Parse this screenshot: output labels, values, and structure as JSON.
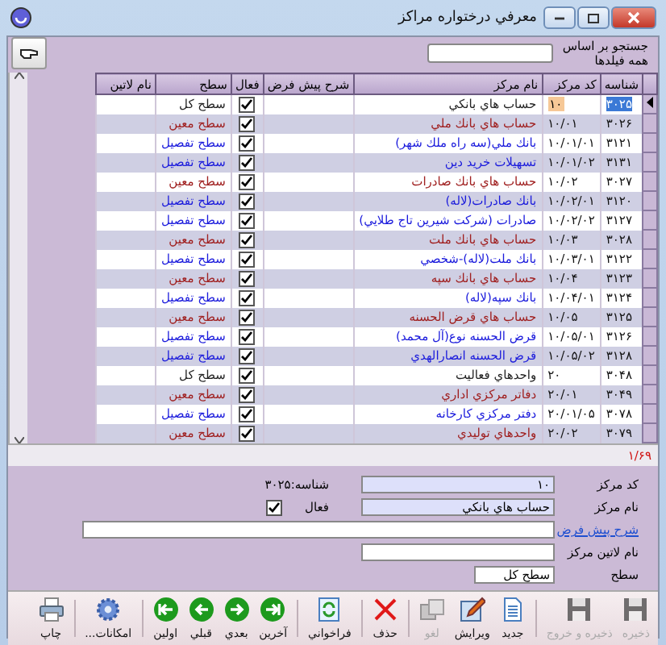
{
  "window": {
    "title": "معرفي درختواره مراكز"
  },
  "search": {
    "label_lines": [
      "جستجو بر اساس",
      "همه فيلدها"
    ]
  },
  "grid": {
    "columns": [
      "شناسه",
      "كد مركز",
      "نام مركز",
      "شرح پيش فرض",
      "فعال",
      "سطح",
      "نام لاتين"
    ],
    "rows": [
      {
        "id": "۳۰۲۵",
        "code": "۱۰",
        "name": "حساب هاي بانكي",
        "active": true,
        "level": "سطح كل",
        "kind": "total",
        "selected": true
      },
      {
        "id": "۳۰۲۶",
        "code": "۱۰/۰۱",
        "name": "حساب هاي بانك ملي",
        "active": true,
        "level": "سطح معين",
        "kind": "ledger",
        "selected": false
      },
      {
        "id": "۳۱۲۱",
        "code": "۱۰/۰۱/۰۱",
        "name": "بانك ملي(سه راه ملك شهر)",
        "active": true,
        "level": "سطح تفصيل",
        "kind": "detail",
        "selected": false
      },
      {
        "id": "۳۱۳۱",
        "code": "۱۰/۰۱/۰۲",
        "name": "تسهيلات خريد دين",
        "active": true,
        "level": "سطح تفصيل",
        "kind": "detail",
        "selected": false
      },
      {
        "id": "۳۰۲۷",
        "code": "۱۰/۰۲",
        "name": "حساب هاي بانك صادرات",
        "active": true,
        "level": "سطح معين",
        "kind": "ledger",
        "selected": false
      },
      {
        "id": "۳۱۲۰",
        "code": "۱۰/۰۲/۰۱",
        "name": "بانك صادرات(لاله)",
        "active": true,
        "level": "سطح تفصيل",
        "kind": "detail",
        "selected": false
      },
      {
        "id": "۳۱۲۷",
        "code": "۱۰/۰۲/۰۲",
        "name": "صادرات (شركت شيرين تاج طلايي)",
        "active": true,
        "level": "سطح تفصيل",
        "kind": "detail",
        "selected": false
      },
      {
        "id": "۳۰۲۸",
        "code": "۱۰/۰۳",
        "name": "حساب هاي بانك ملت",
        "active": true,
        "level": "سطح معين",
        "kind": "ledger",
        "selected": false
      },
      {
        "id": "۳۱۲۲",
        "code": "۱۰/۰۳/۰۱",
        "name": "بانك ملت(لاله)-شخصي",
        "active": true,
        "level": "سطح تفصيل",
        "kind": "detail",
        "selected": false
      },
      {
        "id": "۳۱۲۳",
        "code": "۱۰/۰۴",
        "name": "حساب هاي بانك سپه",
        "active": true,
        "level": "سطح معين",
        "kind": "ledger",
        "selected": false
      },
      {
        "id": "۳۱۲۴",
        "code": "۱۰/۰۴/۰۱",
        "name": "بانك سپه(لاله)",
        "active": true,
        "level": "سطح تفصيل",
        "kind": "detail",
        "selected": false
      },
      {
        "id": "۳۱۲۵",
        "code": "۱۰/۰۵",
        "name": "حساب هاي قرض الحسنه",
        "active": true,
        "level": "سطح معين",
        "kind": "ledger",
        "selected": false
      },
      {
        "id": "۳۱۲۶",
        "code": "۱۰/۰۵/۰۱",
        "name": "قرض الحسنه نوع(آل محمد)",
        "active": true,
        "level": "سطح تفصيل",
        "kind": "detail",
        "selected": false
      },
      {
        "id": "۳۱۲۸",
        "code": "۱۰/۰۵/۰۲",
        "name": "قرض الحسنه انصارالهدي",
        "active": true,
        "level": "سطح تفصيل",
        "kind": "detail",
        "selected": false
      },
      {
        "id": "۳۰۴۸",
        "code": "۲۰",
        "name": "واحدهاي فعاليت",
        "active": true,
        "level": "سطح كل",
        "kind": "total",
        "selected": false
      },
      {
        "id": "۳۰۴۹",
        "code": "۲۰/۰۱",
        "name": "دفاتر مركزي اداري",
        "active": true,
        "level": "سطح معين",
        "kind": "ledger",
        "selected": false
      },
      {
        "id": "۳۰۷۸",
        "code": "۲۰/۰۱/۰۵",
        "name": "دفتر مركزي كارخانه",
        "active": true,
        "level": "سطح تفصيل",
        "kind": "detail",
        "selected": false
      },
      {
        "id": "۳۰۷۹",
        "code": "۲۰/۰۲",
        "name": "واحدهاي توليدي",
        "active": true,
        "level": "سطح معين",
        "kind": "ledger",
        "selected": false
      }
    ],
    "record_counter": "۱/۶۹"
  },
  "form": {
    "code_label": "كد مركز",
    "code_value": "۱۰",
    "id_text": "شناسه:۳۰۲۵",
    "name_label": "نام مركز",
    "name_value": "حساب هاي بانكي",
    "active_label": "فعال",
    "active": true,
    "description_link": "شرح پيش فرض",
    "latin_label": "نام لاتين مركز",
    "level_label": "سطح",
    "level_value": "سطح كل"
  },
  "toolbar": [
    {
      "label": "ذخيره",
      "kind": "save",
      "disabled": true
    },
    {
      "label": "ذخيره و خروج",
      "kind": "save",
      "disabled": true
    },
    {
      "label": "جديد",
      "kind": "new",
      "disabled": false
    },
    {
      "label": "ويرايش",
      "kind": "edit",
      "disabled": false
    },
    {
      "label": "لغو",
      "kind": "cancel",
      "disabled": true
    },
    {
      "label": "حذف",
      "kind": "delete",
      "disabled": false
    },
    {
      "label": "فراخواني",
      "kind": "refresh",
      "disabled": false
    },
    {
      "label": "آخرين",
      "kind": "last",
      "disabled": false
    },
    {
      "label": "بعدي",
      "kind": "next",
      "disabled": false
    },
    {
      "label": "قبلي",
      "kind": "prev",
      "disabled": false
    },
    {
      "label": "اولين",
      "kind": "first",
      "disabled": false
    },
    {
      "label": "امكانات...",
      "kind": "gear",
      "disabled": false
    },
    {
      "label": "چاپ",
      "kind": "print",
      "disabled": false
    }
  ]
}
